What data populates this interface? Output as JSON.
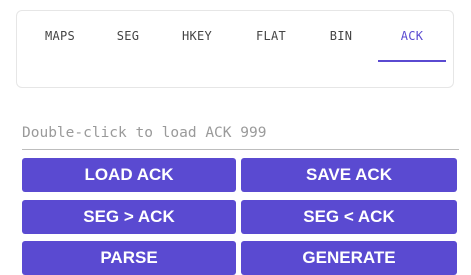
{
  "tabs": [
    {
      "label": "MAPS",
      "active": false
    },
    {
      "label": "SEG",
      "active": false
    },
    {
      "label": "HKEY",
      "active": false
    },
    {
      "label": "FLAT",
      "active": false
    },
    {
      "label": "BIN",
      "active": false
    },
    {
      "label": "ACK",
      "active": true
    }
  ],
  "input": {
    "placeholder": "Double-click to load ACK 999",
    "value": ""
  },
  "buttons": {
    "load_ack": "LOAD ACK",
    "save_ack": "SAVE ACK",
    "seg_to_ack": "SEG > ACK",
    "ack_to_seg": "SEG < ACK",
    "parse": "PARSE",
    "generate": "GENERATE"
  },
  "colors": {
    "accent": "#5a4ad1",
    "button_text": "#ffffff",
    "tab_text": "#444444",
    "placeholder": "#9a9a9a"
  }
}
